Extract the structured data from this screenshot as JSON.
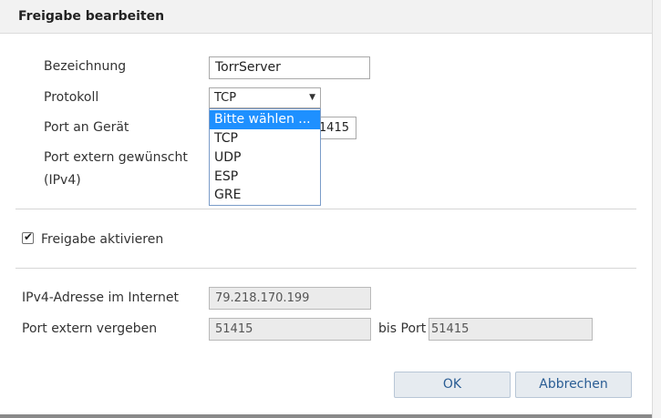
{
  "dialog": {
    "title": "Freigabe bearbeiten"
  },
  "form": {
    "name_label": "Bezeichnung",
    "name_value": "TorrServer",
    "protocol_label": "Protokoll",
    "protocol_value": "TCP",
    "protocol_arrow": "▼",
    "device_port_label": "Port an Gerät",
    "device_port_value": "51415",
    "device_port_visible": "1415",
    "external_port_wanted_label_line1": "Port extern gewünscht",
    "external_port_wanted_label_line2": "(IPv4)",
    "protocol_options": [
      "Bitte wählen ...",
      "TCP",
      "UDP",
      "ESP",
      "GRE"
    ]
  },
  "activate": {
    "checked": true,
    "label": "Freigabe aktivieren"
  },
  "info": {
    "ipv4_label": "IPv4-Adresse im Internet",
    "ipv4_value": "79.218.170.199",
    "port_assigned_label": "Port extern vergeben",
    "port_from_value": "51415",
    "to_port_label": "bis Port",
    "port_to_value": "51415"
  },
  "buttons": {
    "ok": "OK",
    "cancel": "Abbrechen"
  },
  "colors": {
    "selected_option": "#1e90ff",
    "button_text": "#2a5d94"
  }
}
